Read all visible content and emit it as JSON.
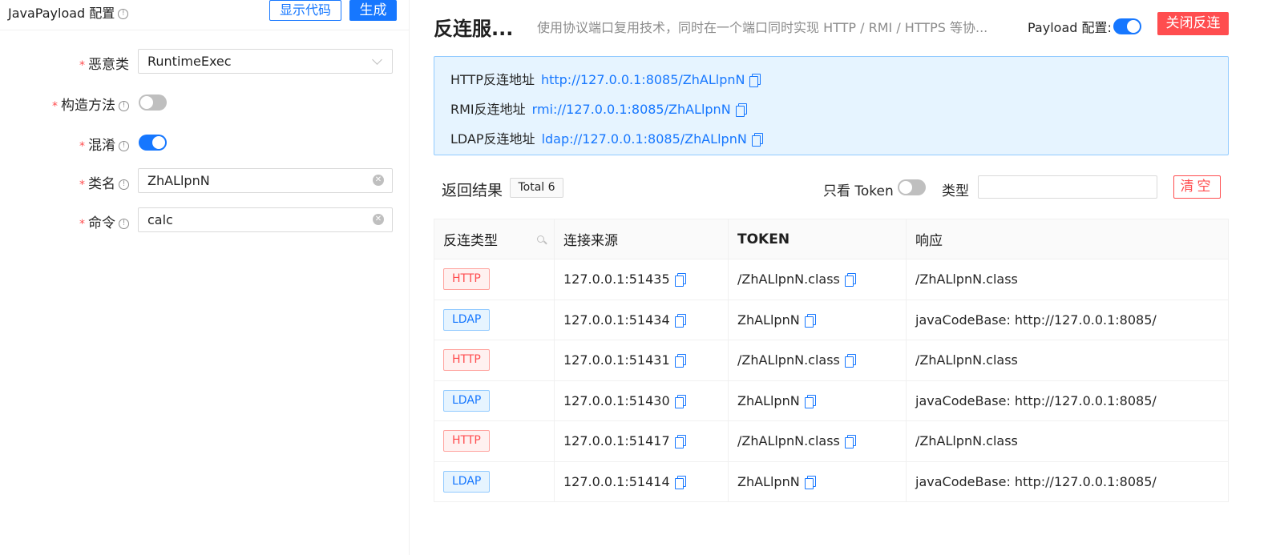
{
  "left": {
    "title": "JavaPayload 配置",
    "show_code_label": "显示代码",
    "generate_label": "生成",
    "fields": {
      "malicious_class": {
        "label": "恶意类",
        "value": "RuntimeExec"
      },
      "constructor": {
        "label": "构造方法",
        "enabled": false
      },
      "obfuscate": {
        "label": "混淆",
        "enabled": true
      },
      "class_name": {
        "label": "类名",
        "value": "ZhALlpnN"
      },
      "command": {
        "label": "命令",
        "value": "calc"
      }
    }
  },
  "right": {
    "title": "反连服...",
    "description": "使用协议端口复用技术，同时在一个端口同时实现 HTTP / RMI / HTTPS 等协...",
    "payload_config_label": "Payload 配置:",
    "payload_config_enabled": true,
    "close_button_label": "关闭反连",
    "addresses": [
      {
        "label": "HTTP反连地址",
        "url": "http://127.0.0.1:8085/ZhALlpnN"
      },
      {
        "label": "RMI反连地址",
        "url": "rmi://127.0.0.1:8085/ZhALlpnN"
      },
      {
        "label": "LDAP反连地址",
        "url": "ldap://127.0.0.1:8085/ZhALlpnN"
      }
    ],
    "results_label": "返回结果",
    "total_label": "Total 6",
    "token_only_label": "只看 Token",
    "token_only_enabled": false,
    "type_label": "类型",
    "type_input_value": "",
    "clear_label": "清空"
  },
  "table": {
    "headers": [
      "反连类型",
      "连接来源",
      "TOKEN",
      "响应"
    ],
    "rows": [
      {
        "type": "HTTP",
        "source": "127.0.0.1:51435",
        "token": "/ZhALlpnN.class",
        "response": "/ZhALlpnN.class"
      },
      {
        "type": "LDAP",
        "source": "127.0.0.1:51434",
        "token": "ZhALlpnN",
        "response": "javaCodeBase: http://127.0.0.1:8085/"
      },
      {
        "type": "HTTP",
        "source": "127.0.0.1:51431",
        "token": "/ZhALlpnN.class",
        "response": "/ZhALlpnN.class"
      },
      {
        "type": "LDAP",
        "source": "127.0.0.1:51430",
        "token": "ZhALlpnN",
        "response": "javaCodeBase: http://127.0.0.1:8085/"
      },
      {
        "type": "HTTP",
        "source": "127.0.0.1:51417",
        "token": "/ZhALlpnN.class",
        "response": "/ZhALlpnN.class"
      },
      {
        "type": "LDAP",
        "source": "127.0.0.1:51414",
        "token": "ZhALlpnN",
        "response": "javaCodeBase: http://127.0.0.1:8085/"
      }
    ]
  },
  "colors": {
    "primary": "#1677ff",
    "danger": "#ff4d4f",
    "info_bg": "#e6f4ff"
  }
}
